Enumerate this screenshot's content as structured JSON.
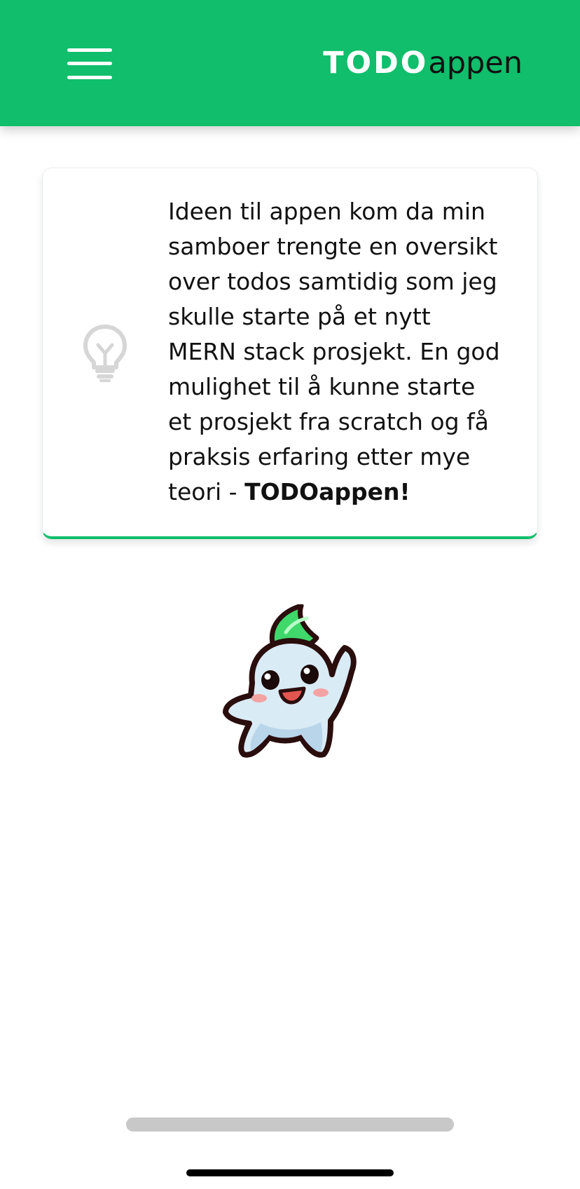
{
  "header": {
    "logo_bold": "TODO",
    "logo_light": "appen",
    "brand_color": "#10be6b"
  },
  "menu": {
    "icon": "hamburger-menu-icon"
  },
  "card": {
    "icon": "lightbulb-icon",
    "text": "Ideen til appen kom da min samboer trengte en oversikt over todos samtidig som jeg skulle starte på et nytt MERN stack prosjekt. En god mulighet til å kunne starte et prosjekt fra scratch og få praksis erfaring etter mye teori - ",
    "text_bold": "TODOappen!"
  },
  "mascot": {
    "icon": "mascot-illustration"
  }
}
